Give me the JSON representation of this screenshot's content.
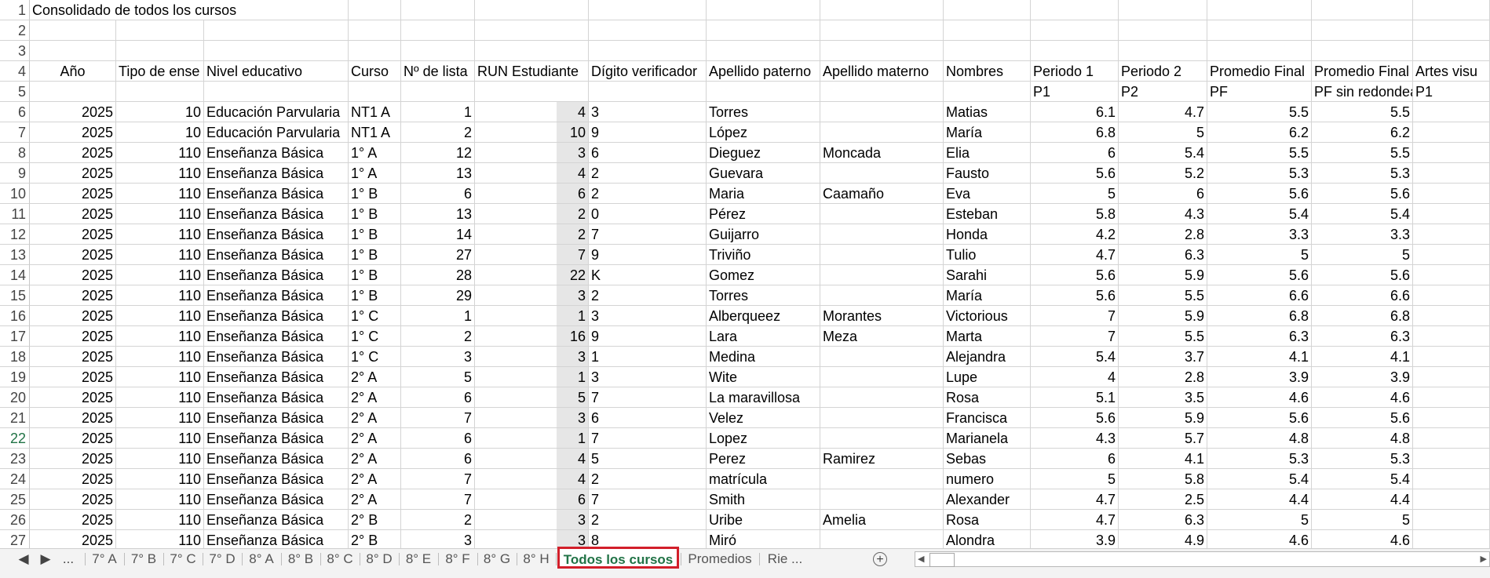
{
  "title": "Consolidado de todos los cursos",
  "headers": [
    "Año",
    "Tipo de ense",
    "Nivel educativo",
    "Curso",
    "Nº de lista",
    "RUN Estudiante",
    "Dígito verificador",
    "Apellido paterno",
    "Apellido materno",
    "Nombres",
    "Periodo 1",
    "Periodo 2",
    "Promedio Final",
    "Promedio Final s",
    "Artes visu"
  ],
  "subheaders": [
    "",
    "",
    "",
    "",
    "",
    "",
    "",
    "",
    "",
    "",
    "P1",
    "P2",
    "PF",
    "PF sin redondear",
    "P1"
  ],
  "rows": [
    {
      "n": "6",
      "cells": [
        "2025",
        "10",
        "Educación Parvularia",
        "NT1 A",
        "1",
        "4",
        "3",
        "Torres",
        "",
        "Matias",
        "6.1",
        "4.7",
        "5.5",
        "5.5"
      ]
    },
    {
      "n": "7",
      "cells": [
        "2025",
        "10",
        "Educación Parvularia",
        "NT1 A",
        "2",
        "10",
        "9",
        "López",
        "",
        "María",
        "6.8",
        "5",
        "6.2",
        "6.2"
      ]
    },
    {
      "n": "8",
      "cells": [
        "2025",
        "110",
        "Enseñanza Básica",
        "1° A",
        "12",
        "3",
        "6",
        "Dieguez",
        "Moncada",
        "Elia",
        "6",
        "5.4",
        "5.5",
        "5.5"
      ]
    },
    {
      "n": "9",
      "cells": [
        "2025",
        "110",
        "Enseñanza Básica",
        "1° A",
        "13",
        "4",
        "2",
        "Guevara",
        "",
        "Fausto",
        "5.6",
        "5.2",
        "5.3",
        "5.3"
      ]
    },
    {
      "n": "10",
      "cells": [
        "2025",
        "110",
        "Enseñanza Básica",
        "1° B",
        "6",
        "6",
        "2",
        "Maria",
        "Caamaño",
        "Eva",
        "5",
        "6",
        "5.6",
        "5.6"
      ]
    },
    {
      "n": "11",
      "cells": [
        "2025",
        "110",
        "Enseñanza Básica",
        "1° B",
        "13",
        "2",
        "0",
        "Pérez",
        "",
        "Esteban",
        "5.8",
        "4.3",
        "5.4",
        "5.4"
      ]
    },
    {
      "n": "12",
      "cells": [
        "2025",
        "110",
        "Enseñanza Básica",
        "1° B",
        "14",
        "2",
        "7",
        "Guijarro",
        "",
        "Honda",
        "4.2",
        "2.8",
        "3.3",
        "3.3"
      ]
    },
    {
      "n": "13",
      "cells": [
        "2025",
        "110",
        "Enseñanza Básica",
        "1° B",
        "27",
        "7",
        "9",
        "Triviño",
        "",
        "Tulio",
        "4.7",
        "6.3",
        "5",
        "5"
      ]
    },
    {
      "n": "14",
      "cells": [
        "2025",
        "110",
        "Enseñanza Básica",
        "1° B",
        "28",
        "22",
        "K",
        "Gomez",
        "",
        "Sarahi",
        "5.6",
        "5.9",
        "5.6",
        "5.6"
      ]
    },
    {
      "n": "15",
      "cells": [
        "2025",
        "110",
        "Enseñanza Básica",
        "1° B",
        "29",
        "3",
        "2",
        "Torres",
        "",
        "María",
        "5.6",
        "5.5",
        "6.6",
        "6.6"
      ]
    },
    {
      "n": "16",
      "cells": [
        "2025",
        "110",
        "Enseñanza Básica",
        "1° C",
        "1",
        "1",
        "3",
        "Alberqueez",
        "Morantes",
        "Victorious",
        "7",
        "5.9",
        "6.8",
        "6.8"
      ]
    },
    {
      "n": "17",
      "cells": [
        "2025",
        "110",
        "Enseñanza Básica",
        "1° C",
        "2",
        "16",
        "9",
        "Lara",
        "Meza",
        "Marta",
        "7",
        "5.5",
        "6.3",
        "6.3"
      ]
    },
    {
      "n": "18",
      "cells": [
        "2025",
        "110",
        "Enseñanza Básica",
        "1° C",
        "3",
        "3",
        "1",
        "Medina",
        "",
        "Alejandra",
        "5.4",
        "3.7",
        "4.1",
        "4.1"
      ]
    },
    {
      "n": "19",
      "cells": [
        "2025",
        "110",
        "Enseñanza Básica",
        "2° A",
        "5",
        "1",
        "3",
        "Wite",
        "",
        "Lupe",
        "4",
        "2.8",
        "3.9",
        "3.9"
      ]
    },
    {
      "n": "20",
      "cells": [
        "2025",
        "110",
        "Enseñanza Básica",
        "2° A",
        "6",
        "5",
        "7",
        "La maravillosa",
        "",
        "Rosa",
        "5.1",
        "3.5",
        "4.6",
        "4.6"
      ]
    },
    {
      "n": "21",
      "cells": [
        "2025",
        "110",
        "Enseñanza Básica",
        "2° A",
        "7",
        "3",
        "6",
        "Velez",
        "",
        "Francisca",
        "5.6",
        "5.9",
        "5.6",
        "5.6"
      ]
    },
    {
      "n": "22",
      "cells": [
        "2025",
        "110",
        "Enseñanza Básica",
        "2° A",
        "6",
        "1",
        "7",
        "Lopez",
        "",
        "Marianela",
        "4.3",
        "5.7",
        "4.8",
        "4.8"
      ]
    },
    {
      "n": "23",
      "cells": [
        "2025",
        "110",
        "Enseñanza Básica",
        "2° A",
        "6",
        "4",
        "5",
        "Perez",
        "Ramirez",
        "Sebas",
        "6",
        "4.1",
        "5.3",
        "5.3"
      ]
    },
    {
      "n": "24",
      "cells": [
        "2025",
        "110",
        "Enseñanza Básica",
        "2° A",
        "7",
        "4",
        "2",
        "matrícula",
        "",
        "numero",
        "5",
        "5.8",
        "5.4",
        "5.4"
      ]
    },
    {
      "n": "25",
      "cells": [
        "2025",
        "110",
        "Enseñanza Básica",
        "2° A",
        "7",
        "6",
        "7",
        "Smith",
        "",
        "Alexander",
        "4.7",
        "2.5",
        "4.4",
        "4.4"
      ]
    },
    {
      "n": "26",
      "cells": [
        "2025",
        "110",
        "Enseñanza Básica",
        "2° B",
        "2",
        "3",
        "2",
        "Uribe",
        "Amelia",
        "Rosa",
        "4.7",
        "6.3",
        "5",
        "5"
      ]
    },
    {
      "n": "27",
      "cells": [
        "2025",
        "110",
        "Enseñanza Básica",
        "2° B",
        "3",
        "3",
        "8",
        "Miró",
        "",
        "Alondra",
        "3.9",
        "4.9",
        "4.6",
        "4.6"
      ]
    }
  ],
  "sheet_tabs": [
    "7° A",
    "7° B",
    "7° C",
    "7° D",
    "8° A",
    "8° B",
    "8° C",
    "8° D",
    "8° E",
    "8° F",
    "8° G",
    "8° H",
    "Todos los cursos",
    "Promedios",
    "Rie ..."
  ],
  "active_tab": "Todos los cursos",
  "tab_nav": {
    "prev": "◀",
    "next": "▶",
    "more": "...",
    "add": "+"
  },
  "selected_row": "22"
}
